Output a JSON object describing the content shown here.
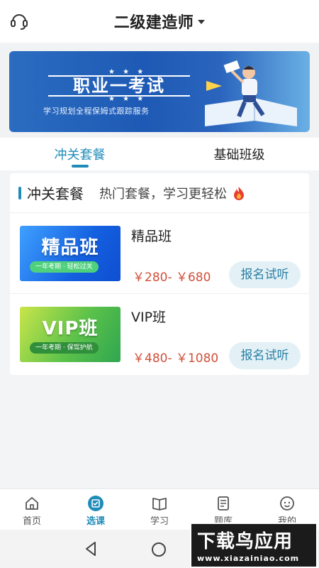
{
  "header": {
    "title": "二级建造师",
    "support_icon": "headset-icon",
    "dropdown_icon": "caret-down-icon"
  },
  "banner": {
    "headline": "职业一考试",
    "subline": "学习规划全程保姆式跟踪服务"
  },
  "tabs": [
    {
      "label": "冲关套餐",
      "active": true
    },
    {
      "label": "基础班级",
      "active": false
    }
  ],
  "section": {
    "title": "冲关套餐",
    "subtitle": "热门套餐，学习更轻松",
    "icon": "fire-icon"
  },
  "courses": [
    {
      "thumb_title": "精品班",
      "thumb_tag": "一年考期 · 轻松过关",
      "name": "精品班",
      "price": "￥280- ￥680",
      "button": "报名试听"
    },
    {
      "thumb_title": "VIP班",
      "thumb_tag": "一年考期 · 保驾护航",
      "name": "VIP班",
      "price": "￥480- ￥1080",
      "button": "报名试听"
    }
  ],
  "bottom_nav": [
    {
      "label": "首页",
      "icon": "home-icon",
      "active": false
    },
    {
      "label": "选课",
      "icon": "course-select-icon",
      "active": true
    },
    {
      "label": "学习",
      "icon": "book-icon",
      "active": false
    },
    {
      "label": "题库",
      "icon": "question-bank-icon",
      "active": false
    },
    {
      "label": "我的",
      "icon": "profile-icon",
      "active": false
    }
  ],
  "watermark": {
    "title": "下载鸟应用",
    "url": "www.xiazainiao.com"
  },
  "colors": {
    "accent": "#1f8cb8",
    "price": "#d0503a",
    "enroll_bg": "#e3f1f6"
  }
}
